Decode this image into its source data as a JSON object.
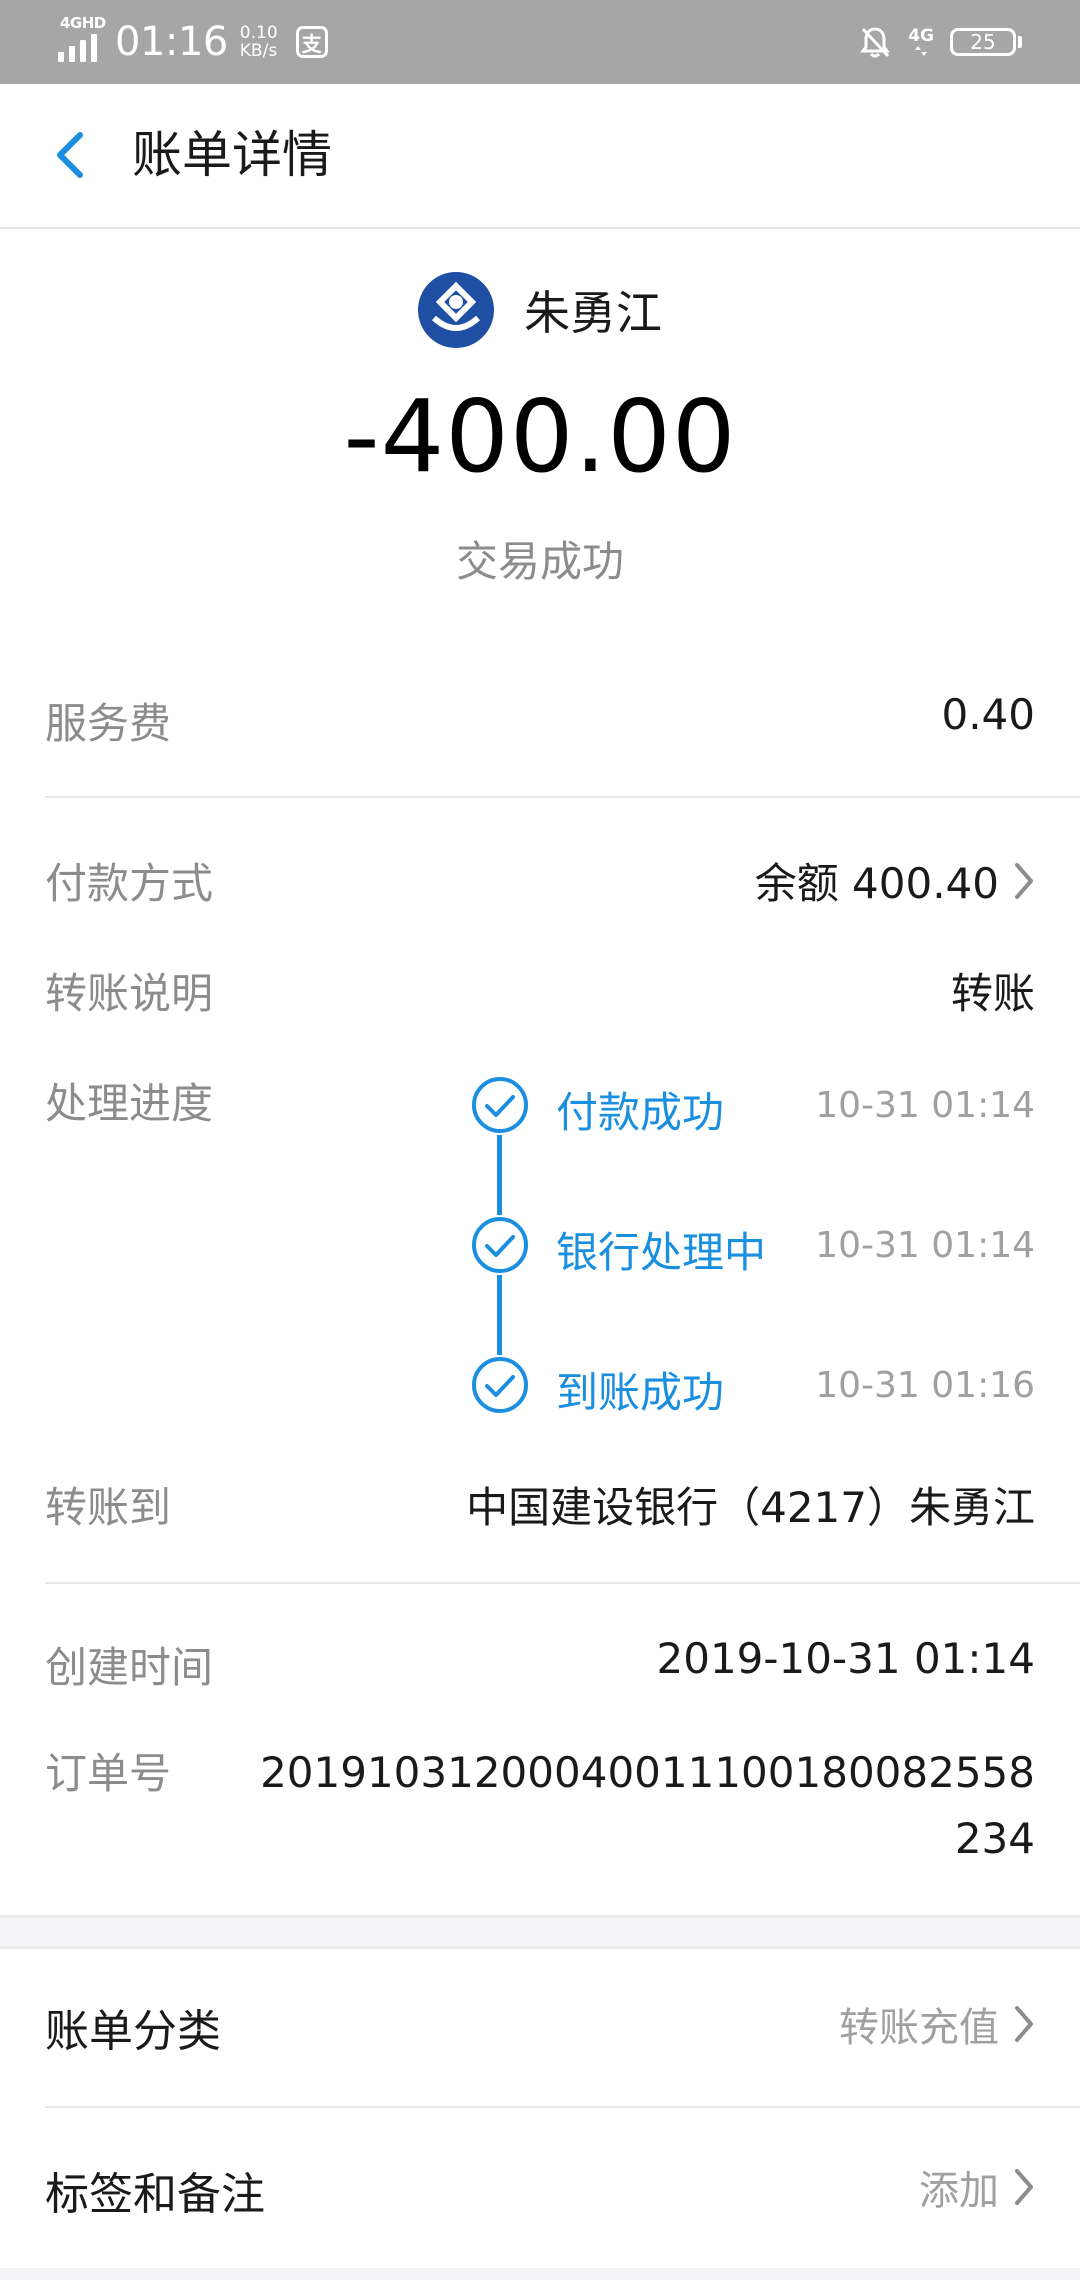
{
  "status_bar": {
    "network_label": "4GHD",
    "time": "01:16",
    "speed_value": "0.10",
    "speed_unit": "KB/s",
    "app_icon": "支",
    "mobile_label": "4G",
    "battery": "25"
  },
  "header": {
    "title": "账单详情"
  },
  "summary": {
    "payee": "朱勇江",
    "amount": "-400.00",
    "status": "交易成功"
  },
  "details": {
    "service_fee_label": "服务费",
    "service_fee_value": "0.40",
    "payment_method_label": "付款方式",
    "payment_method_value": "余额 400.40",
    "transfer_note_label": "转账说明",
    "transfer_note_value": "转账",
    "progress_label": "处理进度",
    "progress_steps": [
      {
        "label": "付款成功",
        "time": "10-31 01:14"
      },
      {
        "label": "银行处理中",
        "time": "10-31 01:14"
      },
      {
        "label": "到账成功",
        "time": "10-31 01:16"
      }
    ],
    "transfer_to_label": "转账到",
    "transfer_to_value": "中国建设银行（4217）朱勇江",
    "created_time_label": "创建时间",
    "created_time_value": "2019-10-31 01:14",
    "order_no_label": "订单号",
    "order_no_value": "20191031200040011100180082558234"
  },
  "menu": {
    "category_label": "账单分类",
    "category_value": "转账充值",
    "tags_label": "标签和备注",
    "tags_value": "添加"
  },
  "colors": {
    "accent": "#1a8fe0",
    "status_bar": "#a6a6a6",
    "bank_logo": "#1e4fa3"
  }
}
